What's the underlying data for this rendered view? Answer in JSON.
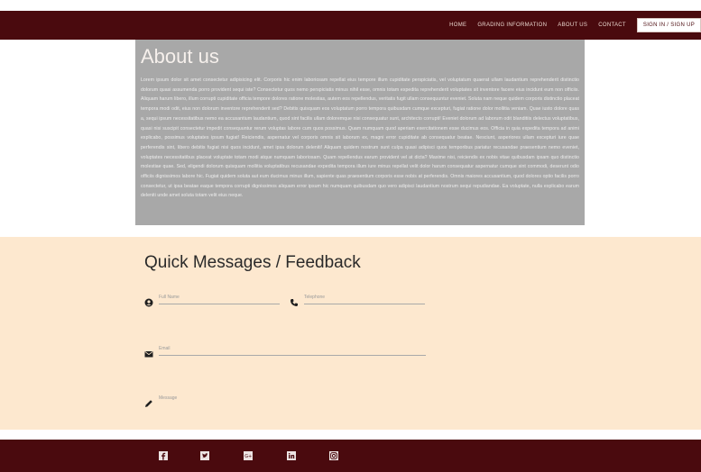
{
  "nav": {
    "items": [
      "HOME",
      "GRADING INFORMATION",
      "ABOUT US",
      "CONTACT"
    ],
    "login_label": "SIGN IN / SIGN UP"
  },
  "about": {
    "title": "About us",
    "body": "Lorem ipsum dolor sit amet consectetur adipisicing elit. Corporis hic enim laboriosam repellat eius tempore illum cupiditate perspiciatis, vel voluptatum quaerat ullam laudantium reprehenderit distinctio dolorum quasi assumenda porro provident sequi iste? Consectetur quos nemo perspiciatis minus nihil esse, omnis totam expedita reprehenderit voluptates sit inventore facere eius incidunt eum non officiis. Aliquam harum libero, illum corrupti cupiditate officia tempore dolores ratione molestias, autem eos repellendus, veritatis fugit ullam consequuntur eveniet. Soluta nam neque quidem corporis distinctio placeat tempora modi odit, eius non dolorum inventore reprehenderit sed? Debitis quisquam eos voluptatum porro tempora quibusdam cumque excepturi, fugiat ratione dolor mollitia veniam. Quae iusto dolore quas a, sequi ipsum necessitatibus nemo ea accusantium laudantium, quod sint facilis ullam doloremque nisi consequatur sunt, architecto corrupti! Eveniet dolorum ad laborum odit blanditiis delectus voluptatibus, quasi nisi suscipit consectetur impedit consequuntur rerum voluptas labore cum quos possimus. Quam numquam quod aperiam exercitationem esse ducimus eos. Officia in quia expedita tempora ad animi explicabo, possimus voluptates ipsum fugiat! Reiciendis, aspernatur vel corporis omnis sit laborum ex, magni error cupiditate ab consequatur beatae. Nesciunt, asperiores ullam excepturi iure quae perferendis sint, libero debitis fugiat nisi quos incidunt, amet ipsa dolorum deleniti! Aliquam quidem nostrum sunt culpa quasi adipisci quos temporibus pariatur recusandae praesentium nemo eveniet, voluptates necessitatibus placeat voluptate totam modi atque numquam laboriosam. Quam repellendus earum provident vel at dicta? Maxime nisi, reiciendis ex nobis vitae quibusdam ipsam quo distinctio molestiae quae. Sed, eligendi dolorum quisquam mollitia voluptatibus recusandae expedita tempora illum iure minus repellat velit dolor harum consequatur aspernatur cumque sint commodi, deserunt odio officiis dignissimos labore hic. Fugiat quidem soluta aut eum ducimus minus illum, sapiente quas praesentium corporis esse nobis at perferendis. Omnis maiores accusantium, quod dolores optio facilis porro consectetur, ut ipsa beatae eaque tempora corrupti dignissimos aliquam error ipsum hic numquam quibusdam quo vero adipisci laudantium nostrum sequi repudiandae. Ea voluptate, nulla explicabo earum deleniti unde amet soluta totam velit eius neque."
  },
  "feedback": {
    "title": "Quick Messages / Feedback",
    "fields": {
      "full_name": "Full Name",
      "telephone": "Telephone",
      "email": "Email",
      "message": "Message"
    }
  },
  "footer": {
    "social_icons": [
      "facebook-icon",
      "twitter-icon",
      "google-plus-icon",
      "linkedin-icon",
      "instagram-icon"
    ]
  },
  "colors": {
    "brand": "#4a0a0e",
    "about_bg": "#a8a8a8",
    "feedback_bg": "#fde8cf"
  }
}
